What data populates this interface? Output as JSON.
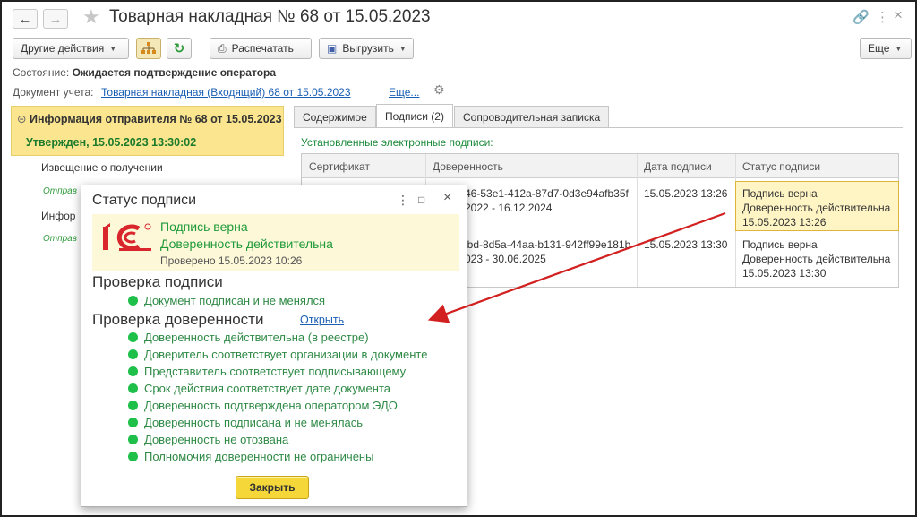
{
  "window": {
    "title": "Товарная накладная № 68 от 15.05.2023"
  },
  "toolbar": {
    "other_actions": "Другие действия",
    "print": "Распечатать",
    "export": "Выгрузить",
    "more": "Еще"
  },
  "status_row": {
    "label": "Состояние:",
    "value": "Ожидается подтверждение оператора"
  },
  "doc_row": {
    "label": "Документ учета:",
    "link": "Товарная накладная (Входящий) 68 от 15.05.2023",
    "more": "Еще..."
  },
  "left_panel": {
    "header": "Информация отправителя № 68 от 15.05.2023",
    "approved": "Утвержден, 15.05.2023 13:30:02",
    "item1": "Извещение о получении",
    "item1_sub": "Отправ",
    "item2": "Инфор",
    "item2_sub": "Отправ"
  },
  "tabs": [
    {
      "label": "Содержимое"
    },
    {
      "label": "Подписи (2)"
    },
    {
      "label": "Сопроводительная записка"
    }
  ],
  "signatures": {
    "title": "Установленные электронные подписи:",
    "columns": [
      "Сертификат",
      "Доверенность",
      "Дата подписи",
      "Статус подписи"
    ],
    "rows": [
      {
        "poa_line1": "46-53e1-412a-87d7-0d3e94afb35f",
        "poa_line2": "2022 - 16.12.2024",
        "date": "15.05.2023 13:26",
        "status_line1": "Подпись верна",
        "status_line2": "Доверенность действительна",
        "status_line3": "15.05.2023 13:26"
      },
      {
        "poa_line1": "lbd-8d5a-44aa-b131-942ff99e181b",
        "poa_line2": "023 - 30.06.2025",
        "date": "15.05.2023 13:30",
        "status_line1": "Подпись верна",
        "status_line2": "Доверенность действительна",
        "status_line3": "15.05.2023 13:30"
      }
    ]
  },
  "dialog": {
    "title": "Статус подписи",
    "banner_line1": "Подпись верна",
    "banner_line2": "Доверенность действительна",
    "banner_line3": "Проверено 15.05.2023 10:26",
    "section1": "Проверка подписи",
    "section1_items": [
      "Документ подписан и не менялся"
    ],
    "section2": "Проверка доверенности",
    "section2_link": "Открыть",
    "section2_items": [
      "Доверенность действительна (в реестре)",
      "Доверитель соответствует организации в документе",
      "Представитель соответствует подписывающему",
      "Срок действия соответствует дате документа",
      "Доверенность подтверждена оператором ЭДО",
      "Доверенность подписана и не менялась",
      "Доверенность не отозвана",
      "Полномочия доверенности не ограничены"
    ],
    "close": "Закрыть"
  },
  "colors": {
    "highlight_yellow": "#fbe68f",
    "ok_green": "#1ec04a",
    "arrow_red": "#d21f1f",
    "link_blue": "#1a5fb4"
  }
}
